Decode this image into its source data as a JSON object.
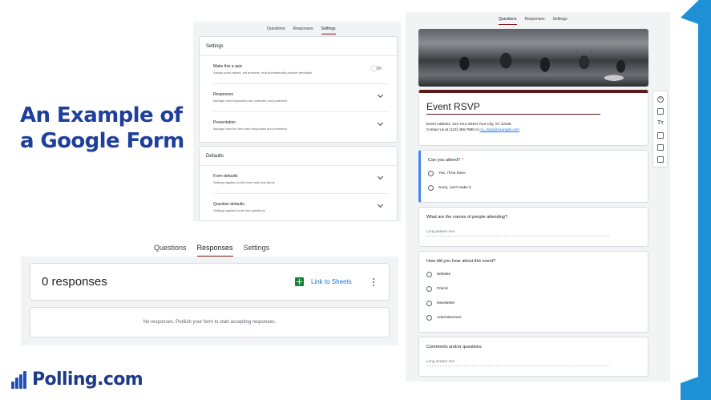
{
  "headline": {
    "line1": "An Example of",
    "line2": "a Google Form"
  },
  "logo": {
    "text": "Polling.com"
  },
  "settings_view": {
    "tabs": [
      "Questions",
      "Responses",
      "Settings"
    ],
    "active_tab": "Settings",
    "section_settings": {
      "title": "Settings",
      "rows": [
        {
          "title": "Make this a quiz",
          "desc": "Assign point values, set answers, and automatically provide feedback",
          "control": "toggle-off"
        },
        {
          "title": "Responses",
          "desc": "Manage how responses are collected and protected",
          "control": "chevron"
        },
        {
          "title": "Presentation",
          "desc": "Manage how the form and responses are presented",
          "control": "chevron"
        }
      ]
    },
    "section_defaults": {
      "title": "Defaults",
      "rows": [
        {
          "title": "Form defaults",
          "desc": "Settings applied to this form and new forms",
          "control": "chevron"
        },
        {
          "title": "Question defaults",
          "desc": "Settings applied to all new questions",
          "control": "chevron"
        }
      ]
    }
  },
  "responses_view": {
    "tabs": [
      "Questions",
      "Responses",
      "Settings"
    ],
    "active_tab": "Responses",
    "count_label": "0 responses",
    "link_label": "Link to Sheets",
    "empty_message": "No responses. Publish your form to start accepting responses."
  },
  "editor_view": {
    "tabs": [
      "Questions",
      "Responses",
      "Settings"
    ],
    "active_tab": "Questions",
    "form_title": "Event RSVP",
    "address": "Event Address: 123 Your Street Your City, ST 12345",
    "contact_prefix": "Contact us at (123) 456-7890 or ",
    "contact_email": "no_reply@example.com",
    "q1": {
      "text": "Can you attend?",
      "required_mark": "*",
      "options": [
        "Yes,  I'll be there",
        "Sorry, can't make it"
      ]
    },
    "q2": {
      "text": "What are the names of people attending?",
      "placeholder": "Long answer text"
    },
    "q3": {
      "text": "How did you hear about this event?",
      "options": [
        "Website",
        "Friend",
        "Newsletter",
        "Advertisement"
      ]
    },
    "q4": {
      "text": "Comments and/or questions",
      "placeholder": "Long answer text"
    },
    "tools": [
      "add-question-icon",
      "import-questions-icon",
      "add-title-icon",
      "add-image-icon",
      "add-video-icon",
      "add-section-icon"
    ]
  },
  "colors": {
    "headline": "#1f3f9c",
    "accent": "#1e90d6",
    "form_theme": "#5c1b1b",
    "link": "#1a73e8",
    "sheets": "#188038"
  }
}
